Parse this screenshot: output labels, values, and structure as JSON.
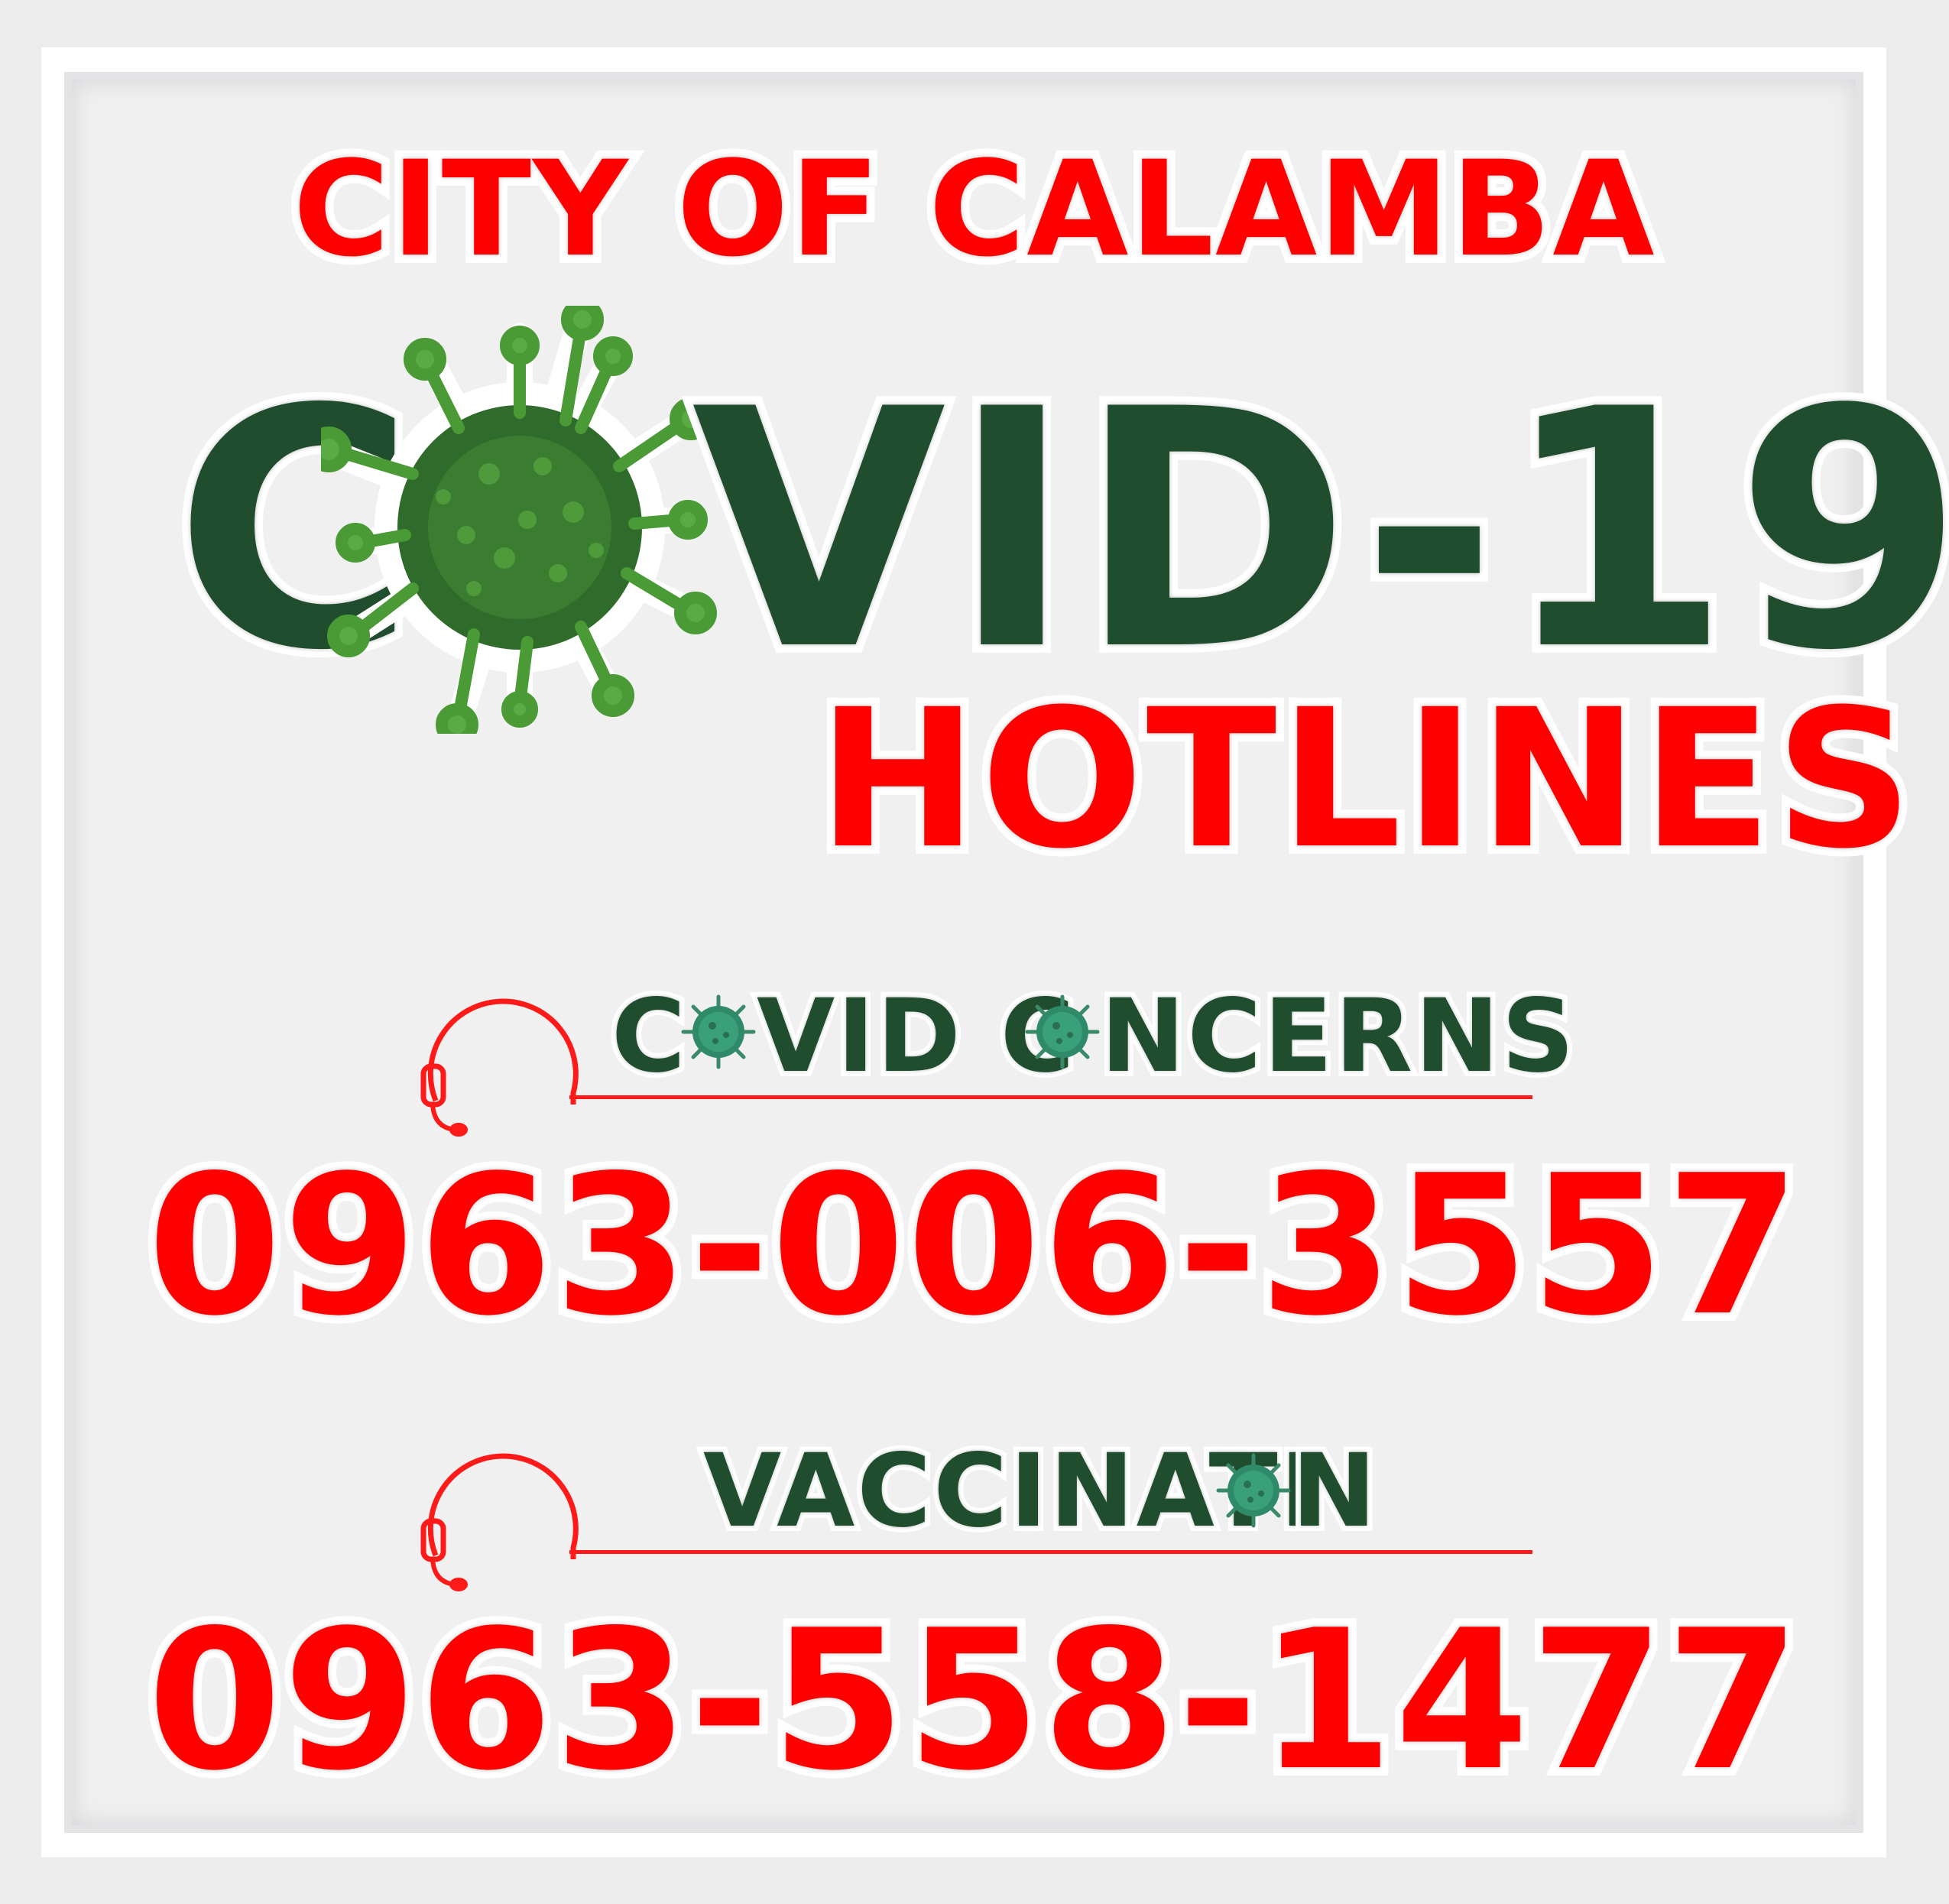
{
  "header": {
    "city": "CITY OF CALAMBA",
    "covid_left": "C",
    "covid_right": "VID-19",
    "hotlines": "HOTLINES"
  },
  "sections": [
    {
      "label_part1": "C",
      "label_part2": "VID C",
      "label_part3": "NCERNS",
      "phone": "0963-006-3557"
    },
    {
      "label_part1": "VACCINATI",
      "label_part2": "N",
      "phone": "0963-558-1477"
    }
  ],
  "colors": {
    "red": "#ff0000",
    "dark_green": "#1f4d2e",
    "virus_green": "#3f8f2f",
    "panel": "#f0f0f0"
  },
  "icons": [
    "coronavirus-icon",
    "headset-icon"
  ]
}
